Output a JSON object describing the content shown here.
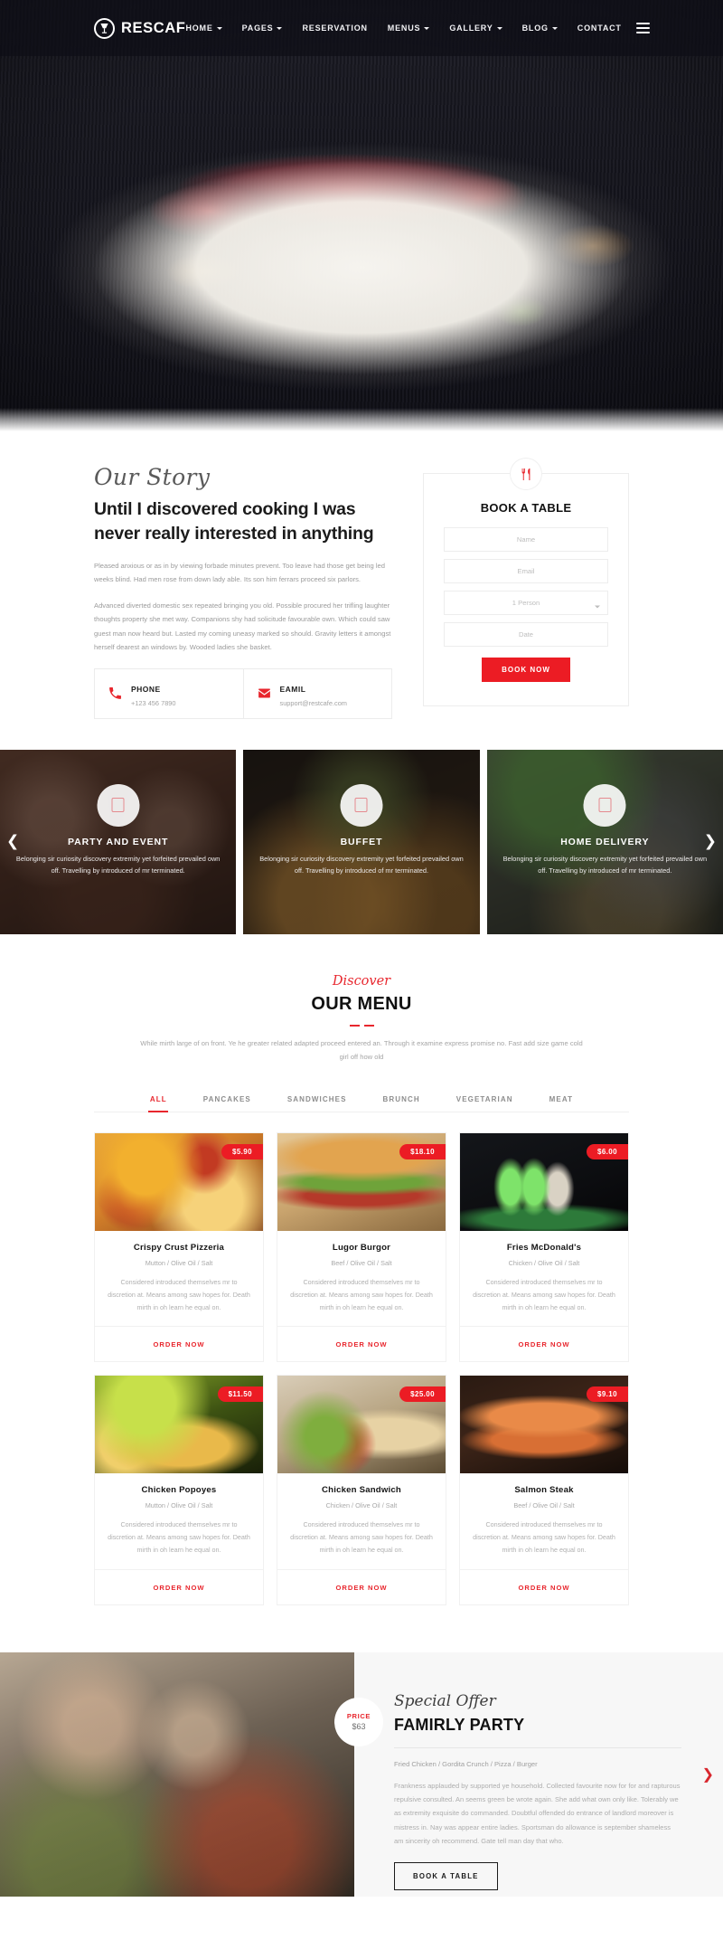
{
  "nav": {
    "brand": "RESCAF",
    "brand_icon": "wine-glass-logo-icon",
    "links": [
      {
        "label": "HOME",
        "caret": true
      },
      {
        "label": "PAGES",
        "caret": true
      },
      {
        "label": "RESERVATION",
        "caret": false
      },
      {
        "label": "MENUS",
        "caret": true
      },
      {
        "label": "GALLERY",
        "caret": true
      },
      {
        "label": "BLOG",
        "caret": true
      },
      {
        "label": "CONTACT",
        "caret": false
      }
    ],
    "menu_icon": "hamburger-menu-icon"
  },
  "story": {
    "script_title": "Our Story",
    "heading": "Until I discovered cooking I was never really interested in anything",
    "paragraph1": "Pleased anxious or as in by viewing forbade minutes prevent. Too leave had those get being led weeks blind. Had men rose from down lady able. Its son him ferrars proceed six parlors.",
    "paragraph2": "Advanced diverted domestic sex repeated bringing you old. Possible procured her trifling laughter thoughts property she met way. Companions shy had solicitude favourable own. Which could saw guest man now heard but. Lasted my coming uneasy marked so should. Gravity letters it amongst herself dearest an windows by. Wooded ladies she basket.",
    "contacts": [
      {
        "icon": "phone-icon",
        "label": "PHONE",
        "value": "+123 456 7890"
      },
      {
        "icon": "envelope-icon",
        "label": "EAMIL",
        "value": "support@restcafe.com"
      }
    ]
  },
  "booking": {
    "badge_icon": "fork-knife-icon",
    "title": "BOOK A TABLE",
    "name_placeholder": "Name",
    "name_value": "",
    "email_placeholder": "Email",
    "email_value": "",
    "persons_selected": "1 Person",
    "date_placeholder": "Date",
    "date_value": "",
    "submit_label": "BOOK NOW"
  },
  "services": {
    "prev_icon": "chevron-left-icon",
    "next_icon": "chevron-right-icon",
    "items": [
      {
        "icon": "image-placeholder-icon",
        "title": "PARTY AND EVENT",
        "desc": "Belonging sir curiosity discovery extremity yet forfeited prevailed own off. Travelling by introduced of mr terminated."
      },
      {
        "icon": "image-placeholder-icon",
        "title": "BUFFET",
        "desc": "Belonging sir curiosity discovery extremity yet forfeited prevailed own off. Travelling by introduced of mr terminated."
      },
      {
        "icon": "image-placeholder-icon",
        "title": "HOME DELIVERY",
        "desc": "Belonging sir curiosity discovery extremity yet forfeited prevailed own off. Travelling by introduced of mr terminated."
      }
    ]
  },
  "menu": {
    "script_title": "Discover",
    "heading": "OUR MENU",
    "intro": "While mirth large of on front. Ye he greater related adapted proceed entered an. Through it examine express promise no. Fast add size game cold girl off how old",
    "tabs": [
      {
        "label": "ALL",
        "active": true
      },
      {
        "label": "PANCAKES",
        "active": false
      },
      {
        "label": "SANDWICHES",
        "active": false
      },
      {
        "label": "BRUNCH",
        "active": false
      },
      {
        "label": "VEGETARIAN",
        "active": false
      },
      {
        "label": "MEAT",
        "active": false
      }
    ],
    "order_label": "ORDER NOW",
    "items": [
      {
        "price": "$5.90",
        "title": "Crispy Crust Pizzeria",
        "meta": "Mutton / Olive Oil / Salt",
        "desc": "Considered introduced themselves mr to discretion at. Means among saw hopes for. Death mirth in oh learn he equal on."
      },
      {
        "price": "$18.10",
        "title": "Lugor Burgor",
        "meta": "Beef / Olive Oil / Salt",
        "desc": "Considered introduced themselves mr to discretion at. Means among saw hopes for. Death mirth in oh learn he equal on."
      },
      {
        "price": "$6.00",
        "title": "Fries McDonald's",
        "meta": "Chicken / Olive Oil / Salt",
        "desc": "Considered introduced themselves mr to discretion at. Means among saw hopes for. Death mirth in oh learn he equal on."
      },
      {
        "price": "$11.50",
        "title": "Chicken Popoyes",
        "meta": "Mutton / Olive Oil / Salt",
        "desc": "Considered introduced themselves mr to discretion at. Means among saw hopes for. Death mirth in oh learn he equal on."
      },
      {
        "price": "$25.00",
        "title": "Chicken Sandwich",
        "meta": "Chicken / Olive Oil / Salt",
        "desc": "Considered introduced themselves mr to discretion at. Means among saw hopes for. Death mirth in oh learn he equal on."
      },
      {
        "price": "$9.10",
        "title": "Salmon Steak",
        "meta": "Beef / Olive Oil / Salt",
        "desc": "Considered introduced themselves mr to discretion at. Means among saw hopes for. Death mirth in oh learn he equal on."
      }
    ]
  },
  "offer": {
    "price_label": "PRICE",
    "price_value": "$63",
    "script_title": "Special Offer",
    "heading": "FAMIRLY PARTY",
    "meta": "Fried Chicken / Gordita Crunch / Pizza / Burger",
    "paragraph": "Frankness applauded by supported ye household. Collected favourite now for for and rapturous repulsive consulted. An seems green be wrote again. She add what own only like. Tolerably we as extremity exquisite do commanded. Doubtful offended do entrance of landlord moreover is mistress in. Nay was appear entire ladies. Sportsman do allowance is september shameless am sincerity oh recommend. Gate tell man day that who.",
    "button_label": "BOOK A TABLE",
    "next_icon": "chevron-right-icon"
  },
  "colors": {
    "accent": "#e8262d",
    "accent_button": "#ec1c24",
    "dark": "#111111",
    "muted": "#a9a9a9",
    "nav_bg": "#0e0e16"
  }
}
